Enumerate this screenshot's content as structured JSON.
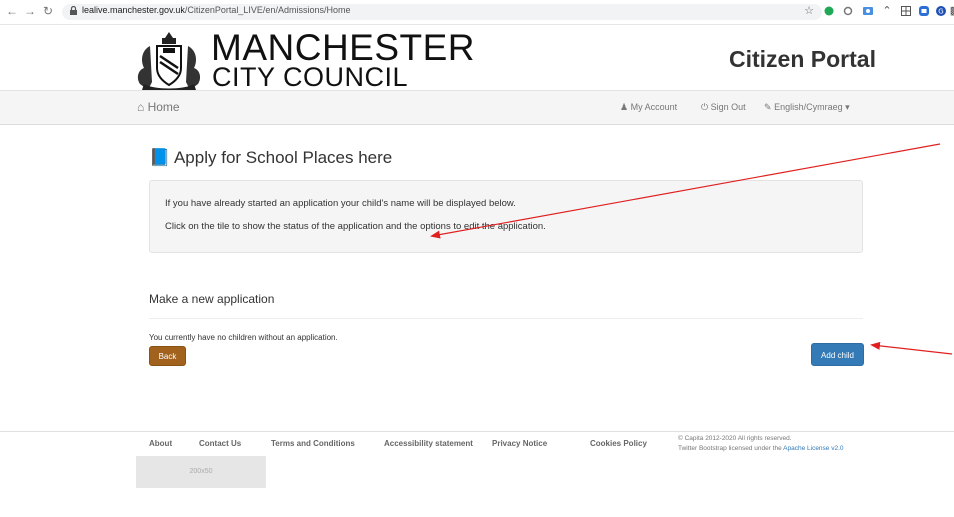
{
  "browser": {
    "back_icon": "arrow-left-icon",
    "forward_icon": "arrow-right-icon",
    "reload_icon": "reload-icon",
    "url_host": "lealive.manchester.gov.uk",
    "url_path": "/CitizenPortal_LIVE/en/Admissions/Home",
    "extension_icons": [
      "star-icon",
      "green-dot-extension-icon",
      "circle-extension-icon",
      "photo-extension-icon",
      "cloud-extension-icon",
      "grid-extension-icon",
      "blue-square-extension-icon",
      "blue-circle-extension-icon",
      "puzzle-icon"
    ]
  },
  "header": {
    "logo_line1": "MANCHESTER",
    "logo_line2": "CITY COUNCIL",
    "portal_title": "Citizen Portal"
  },
  "nav": {
    "home": "Home",
    "my_account": "My Account",
    "sign_out": "Sign Out",
    "language": "English/Cymraeg"
  },
  "main": {
    "heading": "Apply for School Places here",
    "info_line1": "If you have already started an application your child's name will be displayed below.",
    "info_line2": "Click on the tile to show the status of the application and the options to edit the application.",
    "new_heading": "Make a new application",
    "no_children": "You currently have no children without an application.",
    "back_label": "Back",
    "add_child_label": "Add child"
  },
  "footer": {
    "links": [
      "About",
      "Contact Us",
      "Terms and Conditions",
      "Accessibility statement",
      "Privacy Notice",
      "Cookies Policy"
    ],
    "copyright": "© Capita 2012-2020 All rights reserved.",
    "bootstrap_prefix": "Twitter Bootstrap licensed under the ",
    "bootstrap_link": "Apache License v2.0",
    "placeholder": "200x50"
  },
  "colors": {
    "back_button": "#a0621c",
    "add_button": "#337ab7",
    "annotation_arrow": "#e02020"
  }
}
